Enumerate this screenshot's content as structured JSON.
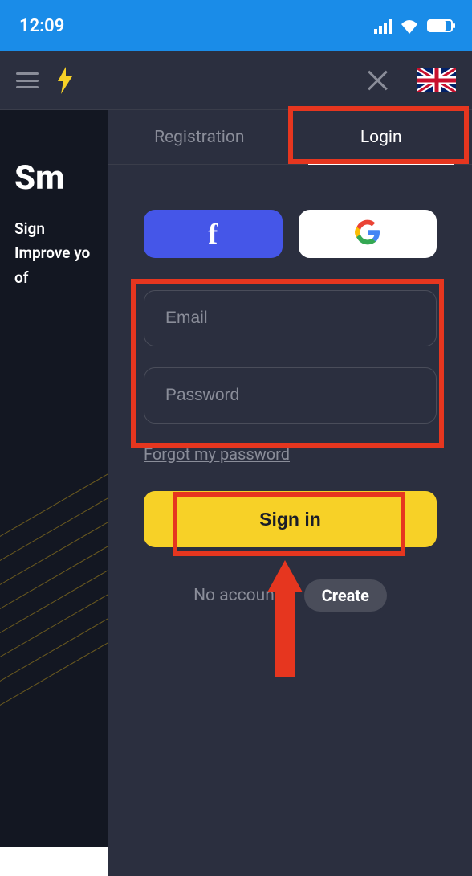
{
  "status": {
    "time": "12:09"
  },
  "background": {
    "title_fragment": "Sm",
    "line1": "Sign",
    "line2": "Improve yo",
    "line3": "of"
  },
  "tabs": {
    "registration": "Registration",
    "login": "Login"
  },
  "form": {
    "email_placeholder": "Email",
    "password_placeholder": "Password",
    "forgot": "Forgot my password",
    "signin": "Sign in",
    "no_account": "No account?",
    "create": "Create"
  },
  "social": {
    "facebook_glyph": "f"
  }
}
